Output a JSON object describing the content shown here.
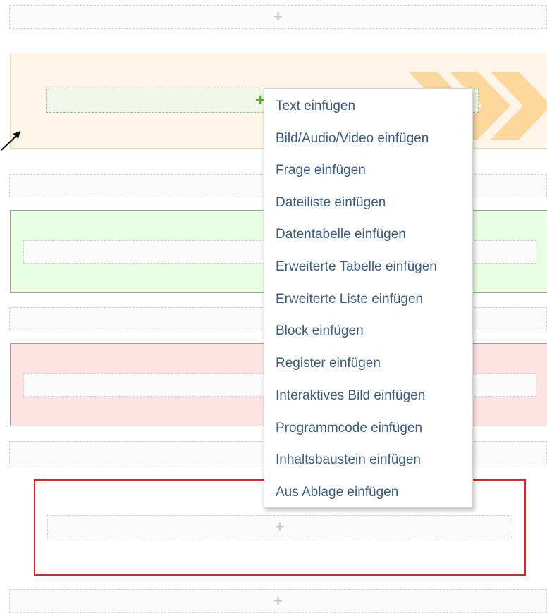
{
  "dropzones": {
    "plus": "+"
  },
  "context_menu": {
    "items": [
      "Text einfügen",
      "Bild/Audio/Video einfügen",
      "Frage einfügen",
      "Dateiliste einfügen",
      "Datentabelle einfügen",
      "Erweiterte Tabelle einfügen",
      "Erweiterte Liste einfügen",
      "Block einfügen",
      "Register einfügen",
      "Interaktives Bild einfügen",
      "Programmcode einfügen",
      "Inhaltsbaustein einfügen",
      "Aus Ablage einfügen"
    ]
  },
  "colors": {
    "menu_text": "#3a5a86",
    "orange_block": "#fff4e8",
    "green_block": "#e8ffe4",
    "red_block": "#ffe3e3",
    "highlight_border": "#e61e1e",
    "chevron": "#fcd79b"
  }
}
